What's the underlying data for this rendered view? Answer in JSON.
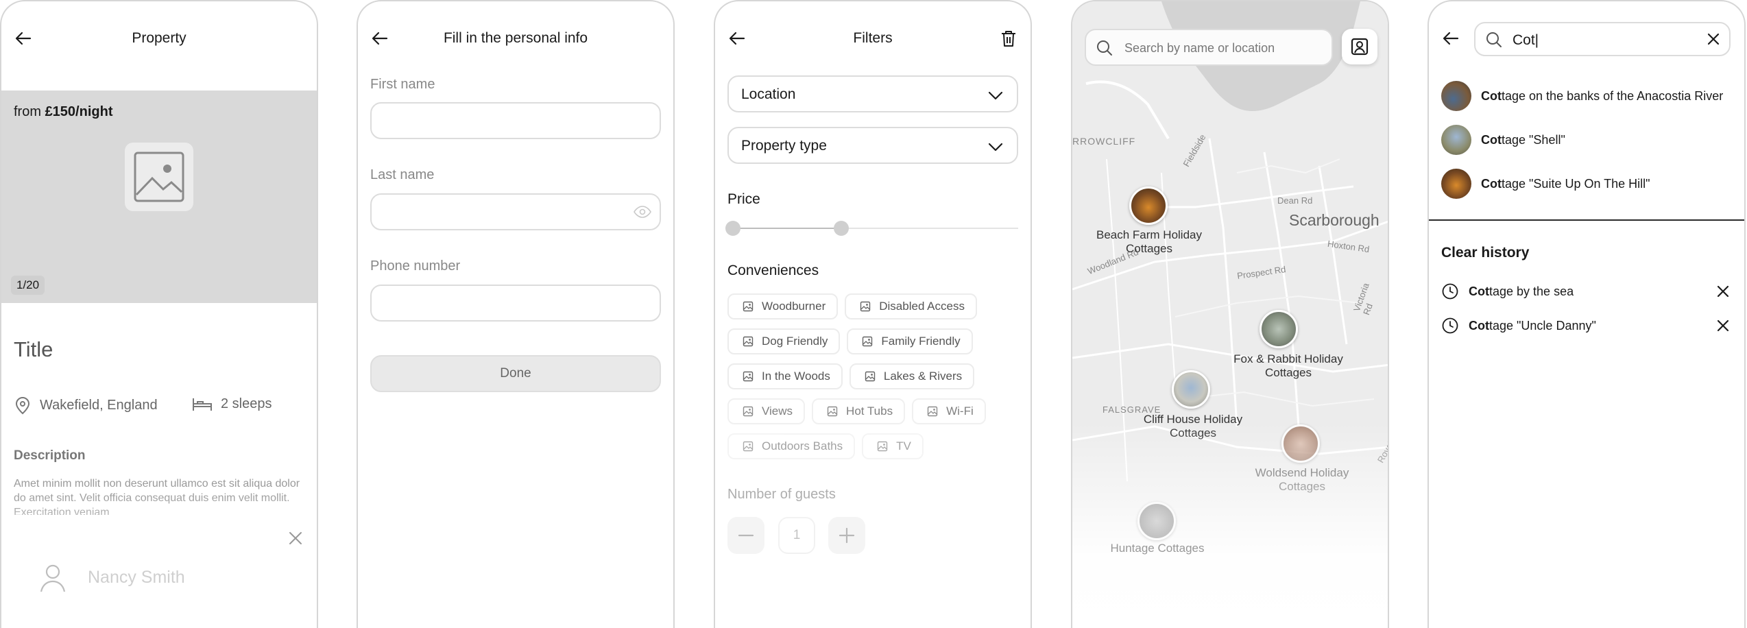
{
  "property_screen": {
    "title": "Property",
    "price_prefix": "from ",
    "price_value": "£150/night",
    "photo_counter": "1/20",
    "listing_title": "Title",
    "location": "Wakefield, England",
    "sleeps": "2 sleeps",
    "description_label": "Description",
    "description_text": "Amet minim mollit non deserunt ullamco est sit aliqua dolor do amet sint. Velit officia consequat duis enim velit mollit. Exercitation veniam",
    "host_name": "Nancy Smith"
  },
  "personal_info_screen": {
    "title": "Fill in the personal info",
    "first_name_label": "First name",
    "last_name_label": "Last name",
    "phone_label": "Phone number",
    "done_label": "Done"
  },
  "filters_screen": {
    "title": "Filters",
    "location_label": "Location",
    "property_type_label": "Property type",
    "price_label": "Price",
    "conveniences_label": "Conveniences",
    "chips": [
      "Woodburner",
      "Disabled Access",
      "Dog Friendly",
      "Family Friendly",
      "In the Woods",
      "Lakes & Rivers",
      "Views",
      "Hot Tubs",
      "Wi-Fi",
      "Outdoors Baths",
      "TV"
    ],
    "guests_label": "Number of guests",
    "guests_value": "1",
    "price_range": {
      "min_fraction": 0.0,
      "max_fraction": 0.38
    }
  },
  "map_screen": {
    "search_placeholder": "Search by name or location",
    "pins": [
      "Beach Farm Holiday Cottages",
      "Fox & Rabbit Holiday Cottages",
      "Cliff House Holiday Cottages",
      "Woldsend Holiday Cottages",
      "Huntage Cottages"
    ],
    "map_labels": {
      "city": "Scarborough",
      "area1": "RROWCLIFF",
      "area2": "FALSGRAVE",
      "road1": "Dean Rd",
      "road2": "Prospect Rd",
      "road3": "Hoxton Rd",
      "road4": "Victoria Rd",
      "road5": "Woodland Rd",
      "road6": "Fieldside",
      "road7": "Royal"
    }
  },
  "search_screen": {
    "query": "Cot|",
    "match": "Cot",
    "results": [
      {
        "match": "Cot",
        "rest": "tage on the banks of the Anacostia River"
      },
      {
        "match": "Cot",
        "rest": "tage \"Shell\""
      },
      {
        "match": "Cot",
        "rest": "tage \"Suite Up On The Hill\""
      }
    ],
    "clear_history_label": "Clear history",
    "history": [
      {
        "match": "Cot",
        "rest": "tage by the sea"
      },
      {
        "match": "Cot",
        "rest": "tage \"Uncle Danny\""
      }
    ]
  },
  "colors": {
    "accent_text": "#1a1a1a",
    "border": "#dcdcdc",
    "placeholder_gray": "#d9d9d9",
    "map_bg": "#ececec"
  }
}
